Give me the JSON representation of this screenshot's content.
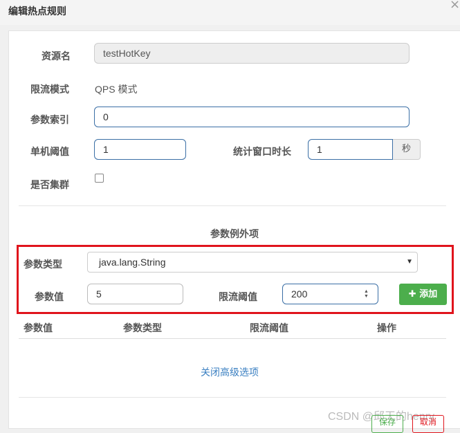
{
  "dialog": {
    "title": "编辑热点规则",
    "close_glyph": "×"
  },
  "form": {
    "resource_label": "资源名",
    "resource_value": "testHotKey",
    "mode_label": "限流模式",
    "mode_value": "QPS 模式",
    "param_index_label": "参数索引",
    "param_index_value": "0",
    "threshold_label": "单机阈值",
    "threshold_value": "1",
    "window_label": "统计窗口时长",
    "window_value": "1",
    "window_unit": "秒",
    "cluster_label": "是否集群",
    "cluster_checked": false
  },
  "exceptions": {
    "title": "参数例外项",
    "type_label": "参数类型",
    "type_value": "java.lang.String",
    "value_label": "参数值",
    "value_value": "5",
    "limit_label": "限流阈值",
    "limit_value": "200",
    "add_label": "添加",
    "columns": [
      "参数值",
      "参数类型",
      "限流阈值",
      "操作"
    ]
  },
  "advanced_link": "关闭高级选项",
  "footer": {
    "save": "保存",
    "cancel": "取消"
  },
  "watermark": "CSDN @邱天的henry",
  "colors": {
    "primary_border": "#3a6ea5",
    "success": "#4cae4c",
    "highlight": "#e0141c",
    "link": "#3a7fc1"
  }
}
